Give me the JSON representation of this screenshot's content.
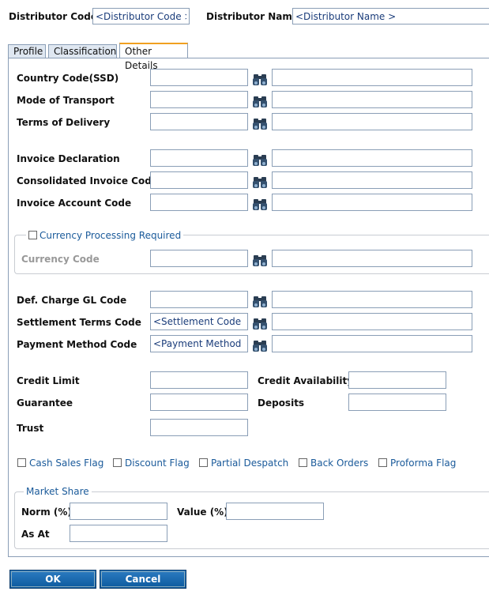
{
  "header": {
    "distributor_code_label": "Distributor Code",
    "distributor_code_placeholder": "<Distributor Code >",
    "distributor_name_label": "Distributor Name",
    "distributor_name_placeholder": "<Distributor Name >"
  },
  "tabs": [
    {
      "label": "Profile"
    },
    {
      "label": "Classification"
    },
    {
      "label": "Other Details"
    }
  ],
  "fields": {
    "country_code": {
      "label": "Country Code(SSD)"
    },
    "mode_of_transport": {
      "label": "Mode of Transport"
    },
    "terms_of_delivery": {
      "label": "Terms of Delivery"
    },
    "invoice_declaration": {
      "label": "Invoice Declaration"
    },
    "consolidated_invoice_code": {
      "label": "Consolidated Invoice Code"
    },
    "invoice_account_code": {
      "label": "Invoice Account Code"
    },
    "currency_code": {
      "label": "Currency Code"
    },
    "def_charge_gl_code": {
      "label": "Def. Charge GL Code"
    },
    "settlement_terms_code": {
      "label": "Settlement Terms Code",
      "placeholder": "<Settlement Code >"
    },
    "payment_method_code": {
      "label": "Payment Method Code",
      "placeholder": "<Payment Method Co"
    },
    "credit_limit": {
      "label": "Credit Limit"
    },
    "credit_availability": {
      "label": "Credit Availability"
    },
    "guarantee": {
      "label": "Guarantee"
    },
    "deposits": {
      "label": "Deposits"
    },
    "trust": {
      "label": "Trust"
    }
  },
  "currency_group": {
    "legend": "Currency Processing Required"
  },
  "flags": [
    {
      "label": "Cash Sales Flag"
    },
    {
      "label": "Discount Flag"
    },
    {
      "label": "Partial Despatch"
    },
    {
      "label": "Back Orders"
    },
    {
      "label": "Proforma Flag"
    }
  ],
  "market_share": {
    "legend": "Market Share",
    "norm_label": "Norm (%)",
    "value_label": "Value (%)",
    "as_at_label": "As At"
  },
  "buttons": {
    "ok": "OK",
    "cancel": "Cancel"
  },
  "icons": {
    "lookup": "binoculars-icon"
  },
  "colors": {
    "button": "#0d5a9e",
    "active_tab_border": "#f0a020",
    "link_text": "#1a5a9a"
  }
}
